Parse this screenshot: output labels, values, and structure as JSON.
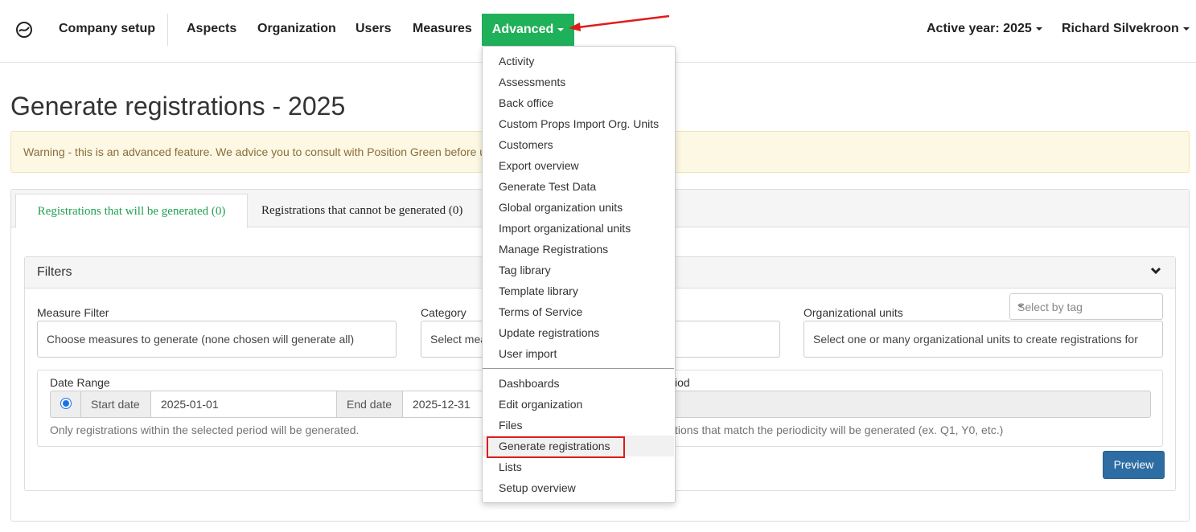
{
  "navbar": {
    "company_setup": "Company setup",
    "aspects": "Aspects",
    "organization": "Organization",
    "users": "Users",
    "measures": "Measures",
    "advanced": "Advanced",
    "active_year": "Active year: 2025",
    "user_name": "Richard Silvekroon",
    "accent_color": "#1fb05a"
  },
  "page": {
    "title": "Generate registrations - 2025",
    "warning": "Warning - this is an advanced feature. We advice you to consult with Position Green before u"
  },
  "tabs": {
    "active": "Registrations that will be generated (0)",
    "inactive": "Registrations that cannot be generated (0)"
  },
  "filters": {
    "title": "Filters",
    "measure_label": "Measure Filter",
    "measure_placeholder": "Choose measures to generate (none chosen will generate all)",
    "category_label": "Category",
    "category_placeholder": "Select mea",
    "tag_select": "Select by tag",
    "org_label": "Organizational units",
    "org_placeholder": "Select one or many organizational units to create registrations for",
    "date_range_label": "Date Range",
    "start_label": "Start date",
    "start_value": "2025-01-01",
    "end_label": "End date",
    "end_value": "2025-12-31",
    "date_help": "Only registrations within the selected period will be generated.",
    "period_label": "iod",
    "period_help": "tions that match the periodicity will be generated (ex. Q1, Y0, etc.)",
    "preview": "Preview"
  },
  "dropdown": {
    "group1": [
      "Activity",
      "Assessments",
      "Back office",
      "Custom Props Import Org. Units",
      "Customers",
      "Export overview",
      "Generate Test Data",
      "Global organization units",
      "Import organizational units",
      "Manage Registrations",
      "Tag library",
      "Template library",
      "Terms of Service",
      "Update registrations",
      "User import"
    ],
    "group2": [
      "Dashboards",
      "Edit organization",
      "Files",
      "Generate registrations",
      "Lists",
      "Setup overview"
    ],
    "highlighted": "Generate registrations"
  }
}
